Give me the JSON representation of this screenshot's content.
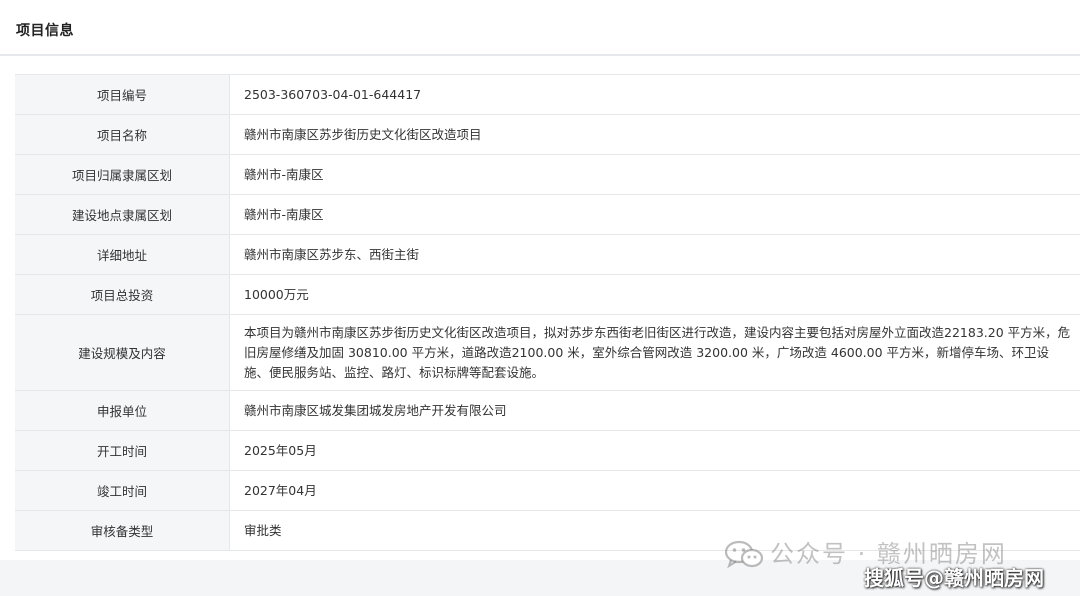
{
  "header": {
    "title": "项目信息"
  },
  "rows": [
    {
      "label": "项目编号",
      "value": "2503-360703-04-01-644417"
    },
    {
      "label": "项目名称",
      "value": "赣州市南康区苏步街历史文化街区改造项目"
    },
    {
      "label": "项目归属隶属区划",
      "value": "赣州市-南康区"
    },
    {
      "label": "建设地点隶属区划",
      "value": "赣州市-南康区"
    },
    {
      "label": "详细地址",
      "value": "赣州市南康区苏步东、西街主街"
    },
    {
      "label": "项目总投资",
      "value": "10000万元"
    },
    {
      "label": "建设规模及内容",
      "value": "本项目为赣州市南康区苏步街历史文化街区改造项目，拟对苏步东西街老旧街区进行改造，建设内容主要包括对房屋外立面改造22183.20 平方米，危旧房屋修缮及加固 30810.00 平方米，道路改造2100.00 米，室外综合管网改造 3200.00 米，广场改造 4600.00 平方米，新增停车场、环卫设施、便民服务站、监控、路灯、标识标牌等配套设施。"
    },
    {
      "label": "申报单位",
      "value": "赣州市南康区城发集团城发房地产开发有限公司"
    },
    {
      "label": "开工时间",
      "value": "2025年05月"
    },
    {
      "label": "竣工时间",
      "value": "2027年04月"
    },
    {
      "label": "审核备类型",
      "value": "审批类"
    }
  ],
  "watermarks": {
    "wechat_icon": "wechat-icon",
    "public_account": "公众号 · 赣州晒房网",
    "sohu": "搜狐号@赣州晒房网"
  }
}
